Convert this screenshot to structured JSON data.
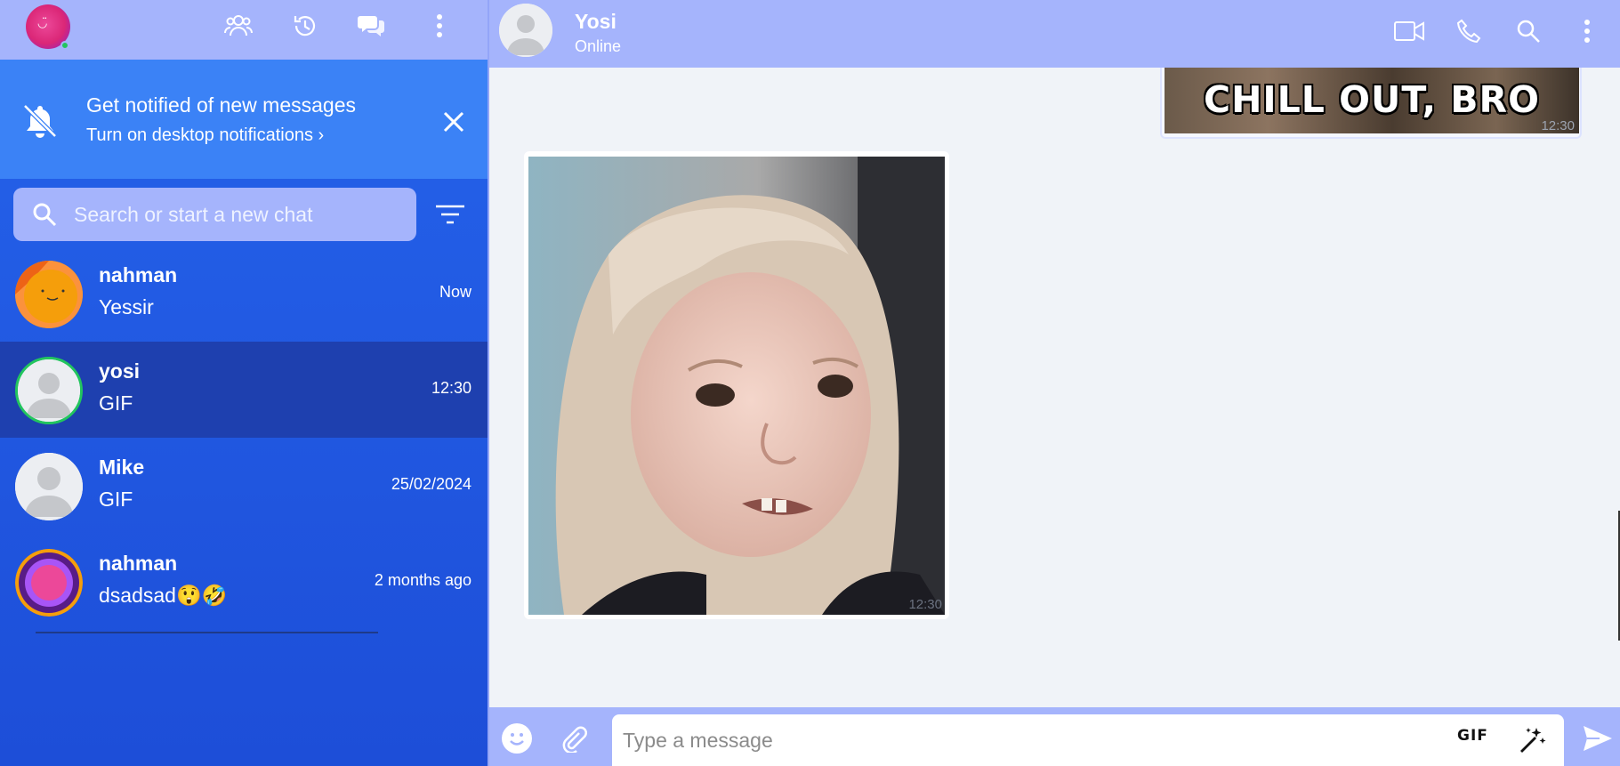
{
  "sidebar": {
    "header_icons": [
      "user-group-icon",
      "history-icon",
      "chat-bubbles-icon",
      "more-vertical-icon"
    ],
    "notification": {
      "title": "Get notified of new messages",
      "link": "Turn on desktop notifications ›"
    },
    "search": {
      "placeholder": "Search or start a new chat"
    },
    "chats": [
      {
        "name": "nahman",
        "message": "Yessir",
        "time": "Now"
      },
      {
        "name": "yosi",
        "message": "GIF",
        "time": "12:30"
      },
      {
        "name": "Mike",
        "message": "GIF",
        "time": "25/02/2024"
      },
      {
        "name": "nahman",
        "message": "dsadsad😲🤣",
        "time": "2 months ago"
      }
    ]
  },
  "conversation": {
    "contact": {
      "name": "Yosi",
      "status": "Online"
    },
    "header_icons": [
      "video-call-icon",
      "phone-icon",
      "search-icon",
      "more-vertical-icon"
    ],
    "messages": [
      {
        "type": "gif",
        "caption": "CHILL OUT, BRO",
        "time": "12:30",
        "direction": "sent"
      },
      {
        "type": "gif",
        "time": "12:30",
        "direction": "received"
      }
    ],
    "composer": {
      "placeholder": "Type a message",
      "gif_label": "GIF"
    }
  },
  "colors": {
    "header": "#a5b4fc",
    "sidebar": "#2563eb",
    "notification": "#3b82f6",
    "active_chat": "#1e40af",
    "chat_background": "#f0f3f8"
  }
}
